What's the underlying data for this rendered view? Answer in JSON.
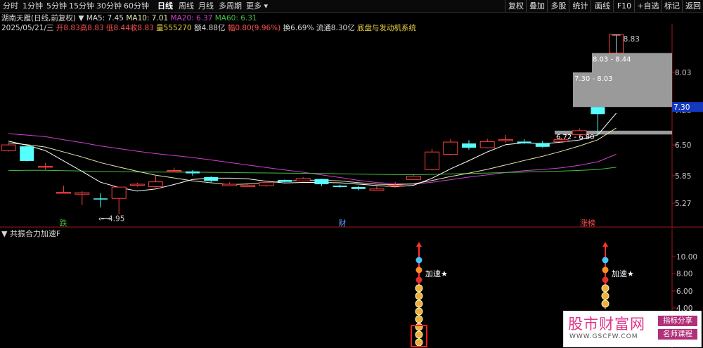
{
  "toolbar": {
    "periods": [
      "分时",
      "1分钟",
      "5分钟",
      "15分钟",
      "30分钟",
      "60分钟",
      "日线",
      "周线",
      "月线",
      "多周期",
      "更多"
    ],
    "active_period": "日线",
    "right_buttons": [
      "复权",
      "叠加",
      "多股",
      "统计",
      "画线",
      "F10",
      "+自选",
      "标记",
      "返回"
    ]
  },
  "info": {
    "stock_name": "湖南天雁(日线,前复权)",
    "ma5": "MA5: 7.45",
    "ma10": "MA10: 7.01",
    "ma20": "MA20: 6.37",
    "ma60": "MA60: 6.31",
    "date": "2025/05/21/三",
    "open": "开8.83",
    "high": "高8.83",
    "low": "低8.44",
    "close": "收8.83",
    "volume": "量555270",
    "amount": "额4.88亿",
    "change": "幅0.80(9.96%)",
    "turnover": "换6.69%",
    "float_cap": "流通8.30亿",
    "concept": "底盘与发动机系统",
    "colors": {
      "up": "#ff4040",
      "down": "#54ffff",
      "ma5": "#ffffff",
      "ma10": "#e8e8b0",
      "ma20": "#d040d0",
      "ma60": "#40c040"
    }
  },
  "main_chart": {
    "price_ticks": [
      "8.03",
      "7.23",
      "6.50",
      "5.85",
      "5.27"
    ],
    "current_price": "7.30",
    "low_label": "4.95",
    "high_label": "8.83",
    "zones": [
      {
        "label": "8.03 - 8.44",
        "from": 8.03,
        "to": 8.44
      },
      {
        "label": "7.30 - 8.03",
        "from": 7.3,
        "to": 8.03
      },
      {
        "label": "6.72 - 6.80",
        "from": 6.72,
        "to": 6.8
      }
    ],
    "markers": [
      {
        "text": "跌",
        "color": "#40c040"
      },
      {
        "text": "财",
        "color": "#54a0ff"
      },
      {
        "text": "涨榜",
        "color": "#ff5050"
      }
    ],
    "candles": [
      {
        "o": 6.38,
        "c": 6.5,
        "h": 6.53,
        "l": 6.36
      },
      {
        "o": 6.47,
        "c": 6.16,
        "h": 6.48,
        "l": 6.15
      },
      {
        "o": 6.05,
        "c": 6.05,
        "h": 6.12,
        "l": 5.98
      },
      {
        "o": 5.5,
        "c": 5.5,
        "h": 5.64,
        "l": 5.5
      },
      {
        "o": 5.46,
        "c": 5.49,
        "h": 5.52,
        "l": 5.23
      },
      {
        "o": 5.37,
        "c": 5.36,
        "h": 5.48,
        "l": 5.18
      },
      {
        "o": 5.37,
        "c": 5.61,
        "h": 5.61,
        "l": 5.04
      },
      {
        "o": 5.66,
        "c": 5.67,
        "h": 5.7,
        "l": 5.62
      },
      {
        "o": 5.62,
        "c": 5.72,
        "h": 5.86,
        "l": 5.6
      },
      {
        "o": 5.95,
        "c": 5.96,
        "h": 6.02,
        "l": 5.92
      },
      {
        "o": 5.94,
        "c": 5.9,
        "h": 5.97,
        "l": 5.85
      },
      {
        "o": 5.82,
        "c": 5.74,
        "h": 5.84,
        "l": 5.71
      },
      {
        "o": 5.64,
        "c": 5.67,
        "h": 5.71,
        "l": 5.64
      },
      {
        "o": 5.62,
        "c": 5.65,
        "h": 5.67,
        "l": 5.61
      },
      {
        "o": 5.64,
        "c": 5.71,
        "h": 5.74,
        "l": 5.62
      },
      {
        "o": 5.76,
        "c": 5.72,
        "h": 5.77,
        "l": 5.71
      },
      {
        "o": 5.74,
        "c": 5.79,
        "h": 5.82,
        "l": 5.73
      },
      {
        "o": 5.78,
        "c": 5.67,
        "h": 5.79,
        "l": 5.63
      },
      {
        "o": 5.64,
        "c": 5.61,
        "h": 5.66,
        "l": 5.6
      },
      {
        "o": 5.61,
        "c": 5.57,
        "h": 5.63,
        "l": 5.54
      },
      {
        "o": 5.54,
        "c": 5.57,
        "h": 5.64,
        "l": 5.53
      },
      {
        "o": 5.65,
        "c": 5.65,
        "h": 5.72,
        "l": 5.63
      },
      {
        "o": 5.77,
        "c": 5.84,
        "h": 5.86,
        "l": 5.76
      },
      {
        "o": 5.98,
        "c": 6.35,
        "h": 6.42,
        "l": 5.96
      },
      {
        "o": 6.3,
        "c": 6.56,
        "h": 6.62,
        "l": 6.28
      },
      {
        "o": 6.53,
        "c": 6.44,
        "h": 6.6,
        "l": 6.4
      },
      {
        "o": 6.44,
        "c": 6.57,
        "h": 6.63,
        "l": 6.43
      },
      {
        "o": 6.61,
        "c": 6.61,
        "h": 6.71,
        "l": 6.55
      },
      {
        "o": 6.57,
        "c": 6.54,
        "h": 6.62,
        "l": 6.52
      },
      {
        "o": 6.54,
        "c": 6.46,
        "h": 6.58,
        "l": 6.44
      },
      {
        "o": 6.57,
        "c": 6.61,
        "h": 6.64,
        "l": 6.55
      },
      {
        "o": 6.72,
        "c": 6.8,
        "h": 6.85,
        "l": 6.68
      },
      {
        "o": 7.3,
        "c": 7.15,
        "h": 7.3,
        "l": 6.7
      },
      {
        "o": 8.44,
        "c": 8.83,
        "h": 8.83,
        "l": 8.44
      }
    ]
  },
  "sub_chart": {
    "title": "共振合力加速F",
    "ticks": [
      "10.00",
      "8.00",
      "6.00",
      "4.00"
    ],
    "signal_label": "加速★"
  },
  "watermark": {
    "title": "股市财富网",
    "url": "WWW.GSCFW.COM",
    "tag1": "指标分享",
    "tag2": "名师课程"
  }
}
